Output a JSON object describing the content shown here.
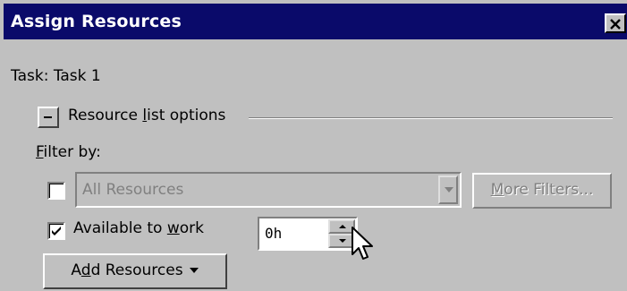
{
  "window": {
    "title": "Assign Resources",
    "close_icon": "close-icon"
  },
  "task": {
    "label": "Task: Task 1"
  },
  "resource_list_options": {
    "toggle_symbol": "-",
    "label_pre": "Resource ",
    "label_accel": "l",
    "label_post": "ist options"
  },
  "filter": {
    "label_accel": "F",
    "label_post": "ilter by:",
    "checked": false,
    "value": "All Resources",
    "dropdown_icon": "chevron-down-icon",
    "more_filters_accel": "M",
    "more_filters_post": "ore Filters..."
  },
  "available": {
    "checked": true,
    "label_pre": "Available to ",
    "label_accel": "w",
    "label_post": "ork",
    "value": "0h"
  },
  "add_resources": {
    "label_pre": "A",
    "label_accel": "d",
    "label_post": "d Resources",
    "menu_icon": "triangle-down-icon"
  },
  "colors": {
    "titlebar": "#0a0a6a",
    "face": "#c0c0c0",
    "disabled_text": "#808080"
  }
}
